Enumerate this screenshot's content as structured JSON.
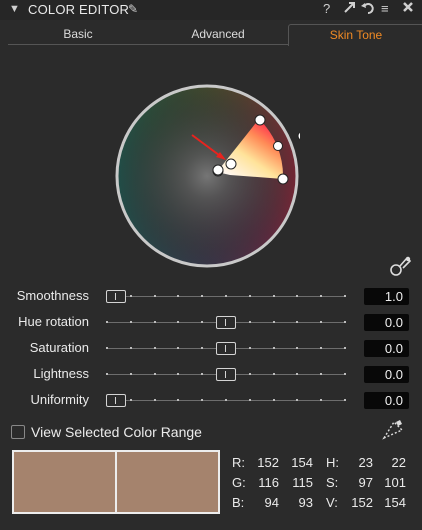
{
  "header": {
    "title": "COLOR EDITOR",
    "icons": [
      "collapse-arrow",
      "pen",
      "help",
      "copy-settings",
      "reset",
      "menu",
      "close"
    ]
  },
  "tabs": [
    {
      "label": "Basic"
    },
    {
      "label": "Advanced"
    },
    {
      "label": "Skin Tone",
      "active": true
    }
  ],
  "colors": {
    "accent": "#f08a24",
    "selection_marker": "#e8231e",
    "swatch": "#a5836d"
  },
  "sliders": [
    {
      "label": "Smoothness",
      "value": "1.0",
      "level": 0.0
    },
    {
      "label": "Hue rotation",
      "value": "0.0",
      "level": 0.5
    },
    {
      "label": "Saturation",
      "value": "0.0",
      "level": 0.5
    },
    {
      "label": "Lightness",
      "value": "0.0",
      "level": 0.5
    },
    {
      "label": "Uniformity",
      "value": "0.0",
      "level": 0.0
    }
  ],
  "view_range": {
    "label": "View Selected Color Range",
    "checked": false
  },
  "readout": {
    "r": {
      "label": "R:",
      "a": "152",
      "b": "154"
    },
    "g": {
      "label": "G:",
      "a": "116",
      "b": "115"
    },
    "b": {
      "label": "B:",
      "a": "94",
      "b": "93"
    },
    "h": {
      "label": "H:",
      "a": "23",
      "b": "22"
    },
    "s": {
      "label": "S:",
      "a": "97",
      "b": "101"
    },
    "v": {
      "label": "V:",
      "a": "152",
      "b": "154"
    }
  }
}
